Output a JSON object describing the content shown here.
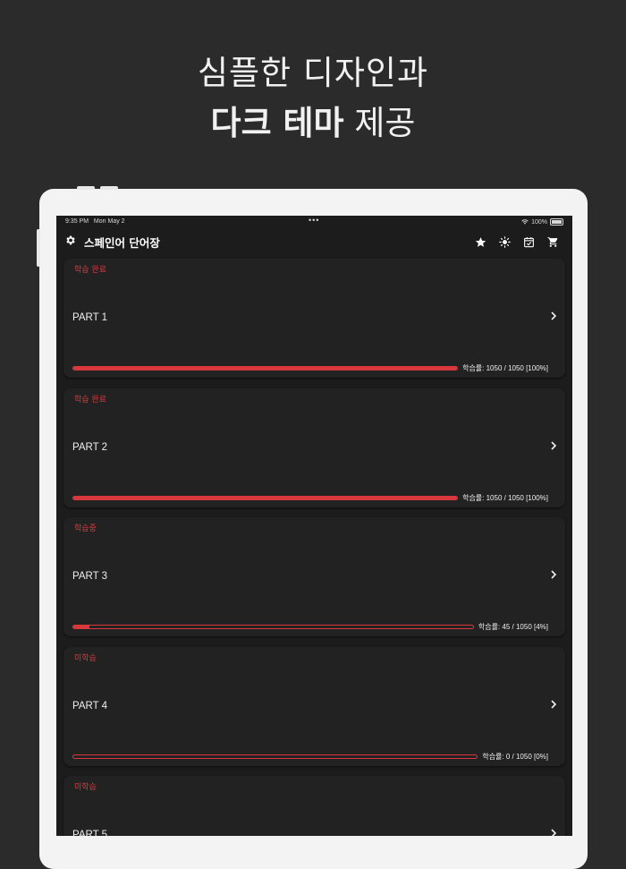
{
  "headline": {
    "line1": "심플한 디자인과",
    "line2_bold": "다크 테마",
    "line2_light": " 제공"
  },
  "statusbar": {
    "time": "9:35 PM",
    "date": "Mon May 2",
    "dots": "•••",
    "battery": "100%"
  },
  "navbar": {
    "title": "스페인어 단어장",
    "icons": [
      "gear-icon",
      "star-icon",
      "brightness-icon",
      "calendar-check-icon",
      "cart-icon"
    ]
  },
  "parts": [
    {
      "status": "학습 완료",
      "name": "PART 1",
      "progress_text": "학습률: 1050 / 1050 [100%]",
      "progress": 1.0
    },
    {
      "status": "학습 완료",
      "name": "PART 2",
      "progress_text": "학습률: 1050 / 1050 [100%]",
      "progress": 1.0
    },
    {
      "status": "학습중",
      "name": "PART 3",
      "progress_text": "학습률: 45 / 1050 [4%]",
      "progress": 0.04
    },
    {
      "status": "미학습",
      "name": "PART 4",
      "progress_text": "학습률: 0 / 1050 [0%]",
      "progress": 0.0
    },
    {
      "status": "미학습",
      "name": "PART 5",
      "progress_text": "",
      "progress": 0.0
    }
  ],
  "colors": {
    "accent": "#d8383d",
    "background": "#2b2b2b",
    "card": "#222222",
    "screen": "#1c1c1c"
  }
}
